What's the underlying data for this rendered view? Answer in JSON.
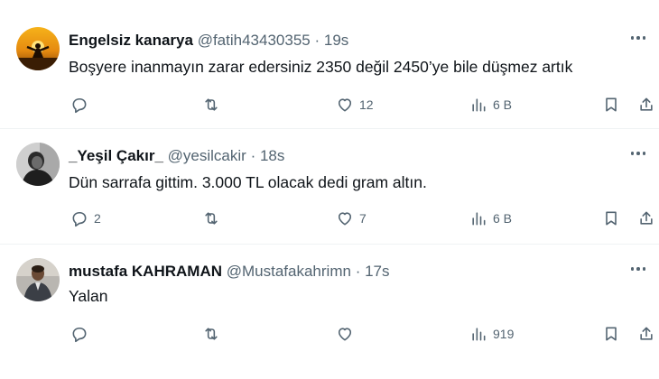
{
  "tweets": [
    {
      "name": "Engelsiz kanarya",
      "handle": "@fatih43430355",
      "separator": "·",
      "time": "19s",
      "text": "Boşyere inanmayın zarar edersiniz 2350 değil 2450’ye bile düşmez artık",
      "replies": "",
      "retweets": "",
      "likes": "12",
      "views": "6 B"
    },
    {
      "name": "_Yeşil Çakır_",
      "handle": "@yesilcakir",
      "separator": "·",
      "time": "18s",
      "text": "Dün sarrafa gittim. 3.000 TL olacak dedi gram altın.",
      "replies": "2",
      "retweets": "",
      "likes": "7",
      "views": "6 B"
    },
    {
      "name": "mustafa KAHRAMAN",
      "handle": "@Mustafakahrimn",
      "separator": "·",
      "time": "17s",
      "text": "Yalan",
      "replies": "",
      "retweets": "",
      "likes": "",
      "views": "919"
    }
  ],
  "colors": {
    "text_primary": "#0f1419",
    "text_secondary": "#536471",
    "divider": "#eff3f4"
  },
  "icons": [
    "reply-icon",
    "retweet-icon",
    "like-icon",
    "views-icon",
    "bookmark-icon",
    "share-icon",
    "more-icon"
  ]
}
